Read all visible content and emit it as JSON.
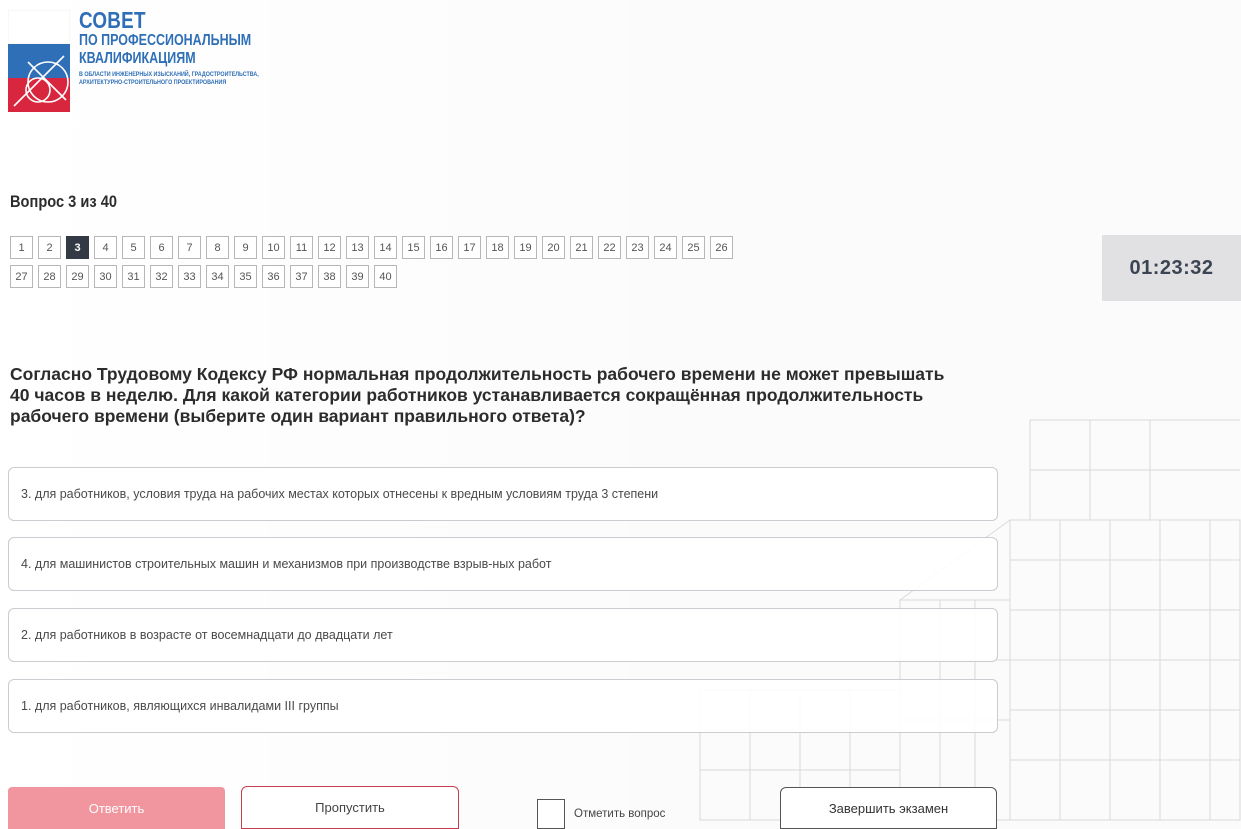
{
  "logo": {
    "line1": "СОВЕТ",
    "line2": "ПО ПРОФЕССИОНАЛЬНЫМ",
    "line3": "КВАЛИФИКАЦИЯМ",
    "sub1": "В ОБЛАСТИ ИНЖЕНЕРНЫХ ИЗЫСКАНИЙ, ГРАДОСТРОИТЕЛЬСТВА,",
    "sub2": "АРХИТЕКТУРНО-СТРОИТЕЛЬНОГО ПРОЕКТИРОВАНИЯ"
  },
  "question_counter": "Вопрос 3 из 40",
  "pager": {
    "current": 3,
    "row1": [
      "1",
      "2",
      "3",
      "4",
      "5",
      "6",
      "7",
      "8",
      "9",
      "10",
      "11",
      "12",
      "13",
      "14",
      "15",
      "16",
      "17",
      "18",
      "19",
      "20",
      "21",
      "22",
      "23",
      "24",
      "25",
      "26"
    ],
    "row2": [
      "27",
      "28",
      "29",
      "30",
      "31",
      "32",
      "33",
      "34",
      "35",
      "36",
      "37",
      "38",
      "39",
      "40"
    ]
  },
  "timer": "01:23:32",
  "question": "Согласно Трудовому Кодексу РФ нормальная продолжительность рабочего времени не может превышать 40 часов в неделю. Для какой категории работников устанавливается сокращённая продолжительность рабочего времени (выберите один вариант правильного ответа)?",
  "answers": [
    "3. для работников, условия труда на рабочих местах которых отнесены к вредным условиям труда 3 степени",
    "4. для машинистов строительных машин и механизмов при производстве взрыв-ных работ",
    "2. для работников в возрасте от восемнадцати до двадцати лет",
    "1. для работников, являющихся инвалидами III группы"
  ],
  "controls": {
    "answer_label": "Ответить",
    "skip_label": "Пропустить",
    "mark_label": "Отметить вопрос",
    "finish_label": "Завершить экзамен"
  },
  "colors": {
    "answer_button": "#f1959f",
    "skip_border": "#c8404f",
    "active_page": "#333a45",
    "timer_bg": "#e1e1e3",
    "logo_blue": "#2f6fb7",
    "logo_red": "#d7263d"
  }
}
